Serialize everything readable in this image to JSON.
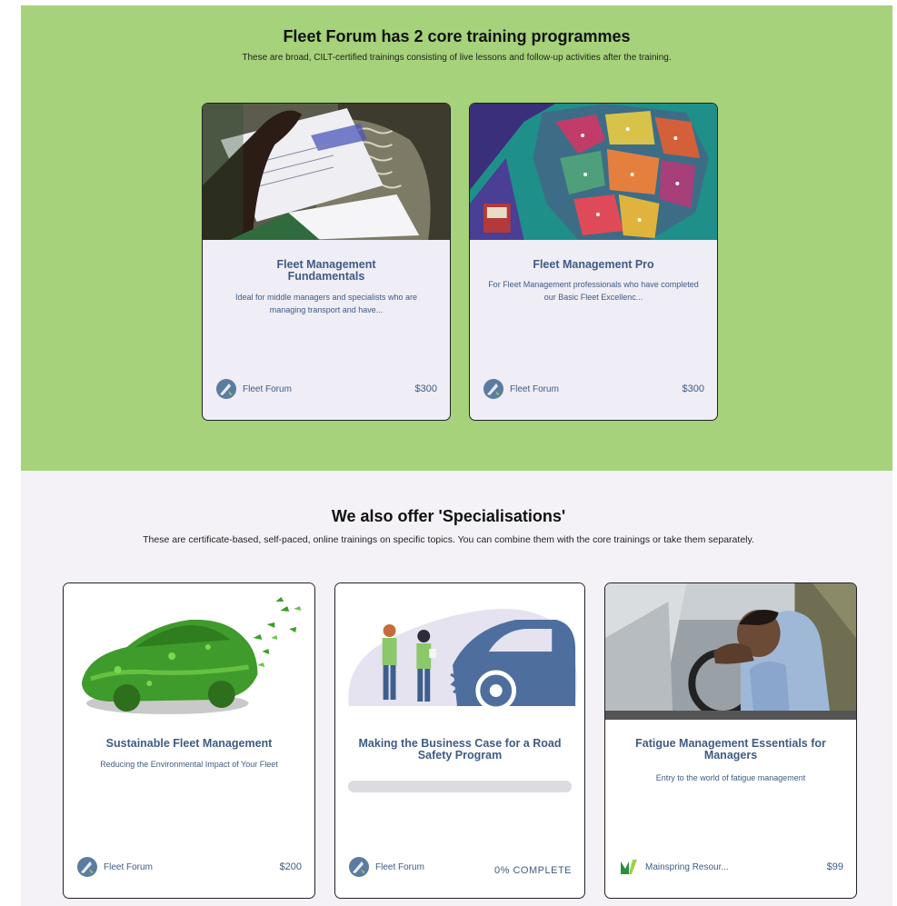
{
  "core": {
    "title": "Fleet Forum has 2 core training programmes",
    "subtitle": "These are broad, CILT-certified trainings consisting of live lessons and follow-up activities after the training.",
    "cards": [
      {
        "title": "Fleet Management Fundamentals",
        "description": "Ideal for middle managers and specialists who are managing transport and have...",
        "provider": "Fleet Forum",
        "price": "$300"
      },
      {
        "title": "Fleet Management Pro",
        "description": "For Fleet Management professionals who have completed our Basic Fleet Excellenc...",
        "provider": "Fleet Forum",
        "price": "$300"
      }
    ]
  },
  "specialisations": {
    "title": "We also offer 'Specialisations'",
    "subtitle": "These are certificate-based, self-paced, online trainings on specific topics. You can combine them with the core trainings or take them separately.",
    "cards": [
      {
        "title": "Sustainable Fleet Management",
        "description": "Reducing the Environmental Impact of Your Fleet",
        "provider": "Fleet Forum",
        "price": "$200"
      },
      {
        "title": "Making the Business Case for a Road Safety Program",
        "provider": "Fleet Forum",
        "progress_label": "0% COMPLETE",
        "progress": 0
      },
      {
        "title": "Fatigue Management Essentials for Managers",
        "description": "Entry to the world of fatigue management",
        "provider": "Mainspring Resour...",
        "price": "$99"
      }
    ]
  },
  "colors": {
    "core_bg": "#a5d27a",
    "spec_bg": "#f4f2f7",
    "card_text": "#3f5b84"
  },
  "icons": {
    "fleet_forum_logo": "fleet-forum-logo-icon",
    "mainspring_logo": "mainspring-logo-icon"
  }
}
